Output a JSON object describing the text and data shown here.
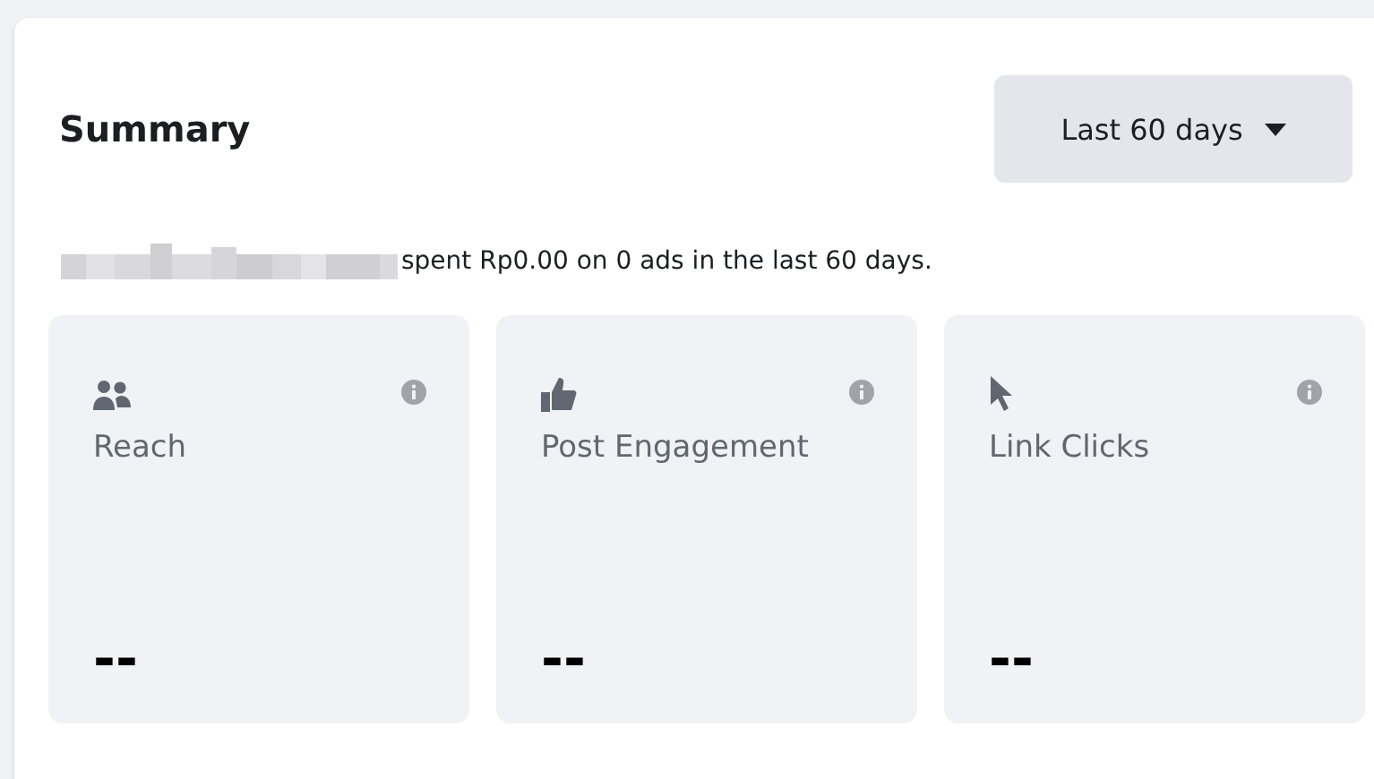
{
  "summary": {
    "title": "Summary",
    "range_button": "Last 60 days",
    "spend_text": "spent Rp0.00 on 0 ads in the last 60 days.",
    "metrics": [
      {
        "kind": "people",
        "label": "Reach",
        "value": "--"
      },
      {
        "kind": "like",
        "label": "Post Engagement",
        "value": "--"
      },
      {
        "kind": "pointer",
        "label": "Link Clicks",
        "value": "--"
      }
    ]
  }
}
